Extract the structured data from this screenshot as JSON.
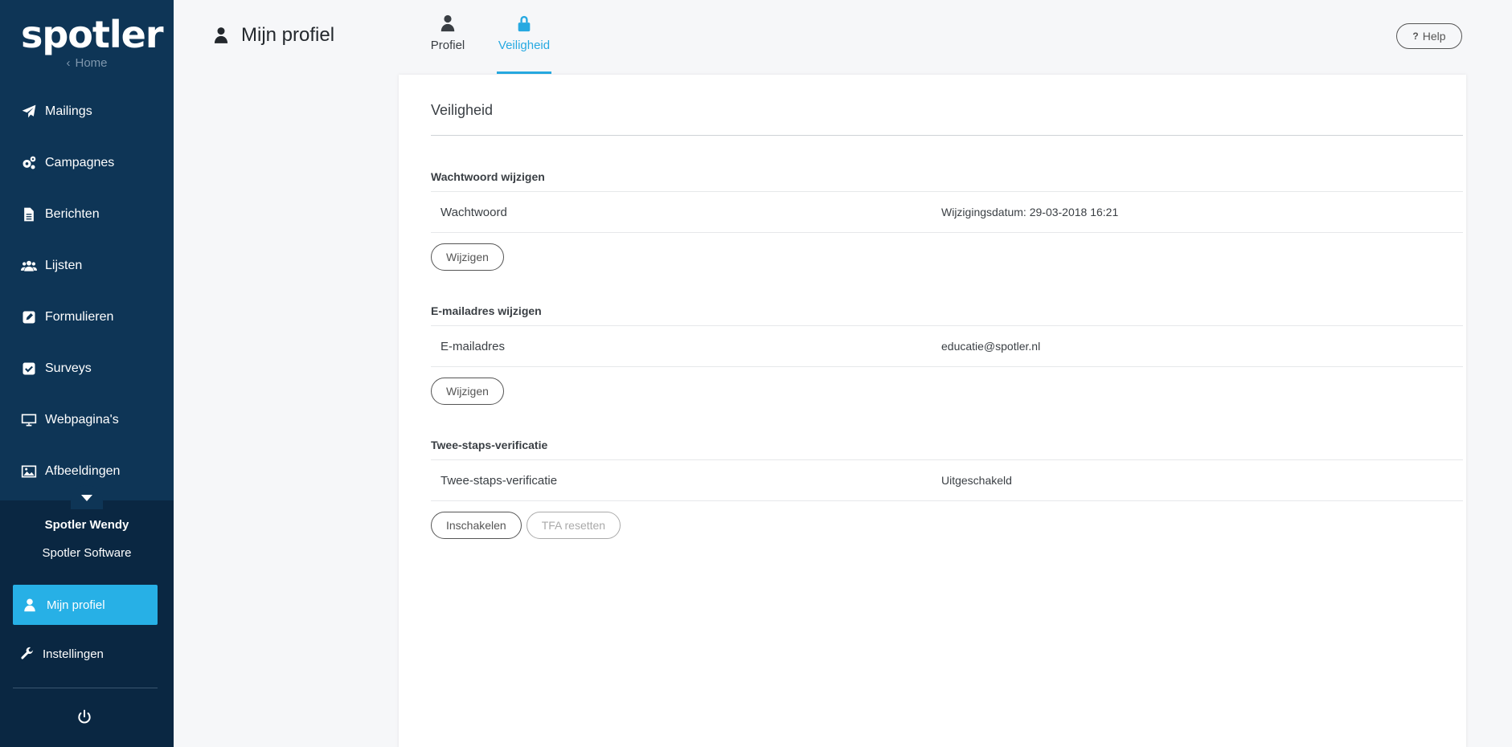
{
  "sidebar": {
    "logo": "spotler",
    "home_label": "Home",
    "items": [
      {
        "label": "Mailings",
        "icon": "paper-plane-icon"
      },
      {
        "label": "Campagnes",
        "icon": "gears-icon"
      },
      {
        "label": "Berichten",
        "icon": "document-icon"
      },
      {
        "label": "Lijsten",
        "icon": "users-icon"
      },
      {
        "label": "Formulieren",
        "icon": "edit-icon"
      },
      {
        "label": "Surveys",
        "icon": "check-square-icon"
      },
      {
        "label": "Webpagina's",
        "icon": "monitor-icon"
      },
      {
        "label": "Afbeeldingen",
        "icon": "image-icon"
      }
    ],
    "user_name": "Spotler Wendy",
    "company": "Spotler Software",
    "profile_label": "Mijn profiel",
    "settings_label": "Instellingen",
    "accent": "#27b0e6",
    "background": "#0e3556"
  },
  "header": {
    "title": "Mijn profiel",
    "tabs": [
      {
        "label": "Profiel",
        "active": false
      },
      {
        "label": "Veiligheid",
        "active": true
      }
    ],
    "help_label": "Help"
  },
  "card": {
    "title": "Veiligheid",
    "sections": [
      {
        "title": "Wachtwoord wijzigen",
        "row_label": "Wachtwoord",
        "row_value": "Wijzigingsdatum: 29-03-2018 16:21",
        "buttons": [
          "Wijzigen"
        ]
      },
      {
        "title": "E-mailadres wijzigen",
        "row_label": "E-mailadres",
        "row_value": "educatie@spotler.nl",
        "buttons": [
          "Wijzigen"
        ]
      },
      {
        "title": "Twee-staps-verificatie",
        "row_label": "Twee-staps-verificatie",
        "row_value": "Uitgeschakeld",
        "buttons": [
          "Inschakelen",
          "TFA resetten"
        ]
      }
    ]
  }
}
